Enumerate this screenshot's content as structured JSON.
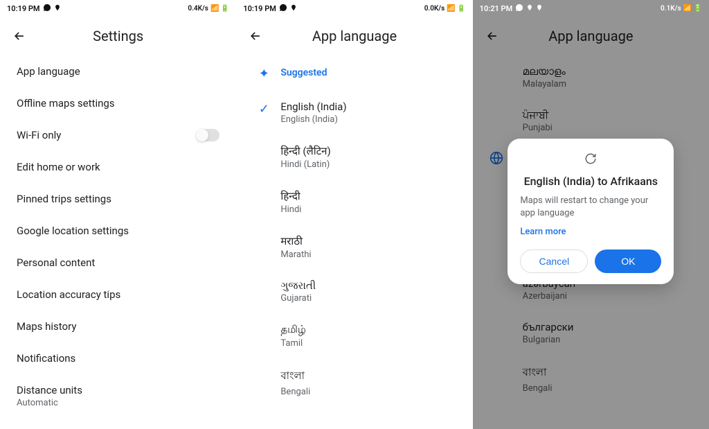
{
  "screen1": {
    "status": {
      "time": "10:19 PM",
      "speed": "0.4K/s"
    },
    "title": "Settings",
    "items": [
      {
        "label": "App language",
        "sub": ""
      },
      {
        "label": "Offline maps settings",
        "sub": ""
      },
      {
        "label": "Wi-Fi only",
        "sub": "",
        "toggle": true
      },
      {
        "label": "Edit home or work",
        "sub": ""
      },
      {
        "label": "Pinned trips settings",
        "sub": ""
      },
      {
        "label": "Google location settings",
        "sub": ""
      },
      {
        "label": "Personal content",
        "sub": ""
      },
      {
        "label": "Location accuracy tips",
        "sub": ""
      },
      {
        "label": "Maps history",
        "sub": ""
      },
      {
        "label": "Notifications",
        "sub": ""
      },
      {
        "label": "Distance units",
        "sub": "Automatic"
      }
    ]
  },
  "screen2": {
    "status": {
      "time": "10:19 PM",
      "speed": "0.0K/s"
    },
    "title": "App language",
    "suggested_label": "Suggested",
    "languages": [
      {
        "native": "English (India)",
        "eng": "English (India)",
        "selected": true
      },
      {
        "native": "हिन्दी (लैटिन)",
        "eng": "Hindi (Latin)"
      },
      {
        "native": "हिन्दी",
        "eng": "Hindi"
      },
      {
        "native": "मराठी",
        "eng": "Marathi"
      },
      {
        "native": "ગુજરાતી",
        "eng": "Gujarati"
      },
      {
        "native": "தமிழ்",
        "eng": "Tamil"
      },
      {
        "native": "বাংলা",
        "eng": "Bengali"
      }
    ]
  },
  "screen3": {
    "status": {
      "time": "10:21 PM",
      "speed": "0.1K/s"
    },
    "title": "App language",
    "bg_items": [
      {
        "native": "മലയാളം",
        "eng": "Malayalam"
      },
      {
        "native": "ਪੰਜਾਬੀ",
        "eng": "Punjabi"
      },
      {
        "native": "",
        "eng": ""
      },
      {
        "native": "",
        "eng": ""
      },
      {
        "native": "",
        "eng": ""
      },
      {
        "native": "azərbaycan",
        "eng": "Azerbaijani"
      },
      {
        "native": "български",
        "eng": "Bulgarian"
      },
      {
        "native": "বাংলা",
        "eng": "Bengali"
      }
    ],
    "dialog": {
      "title": "English (India) to Afrikaans",
      "body": "Maps will restart to change your app language",
      "link": "Learn more",
      "cancel": "Cancel",
      "ok": "OK"
    }
  }
}
